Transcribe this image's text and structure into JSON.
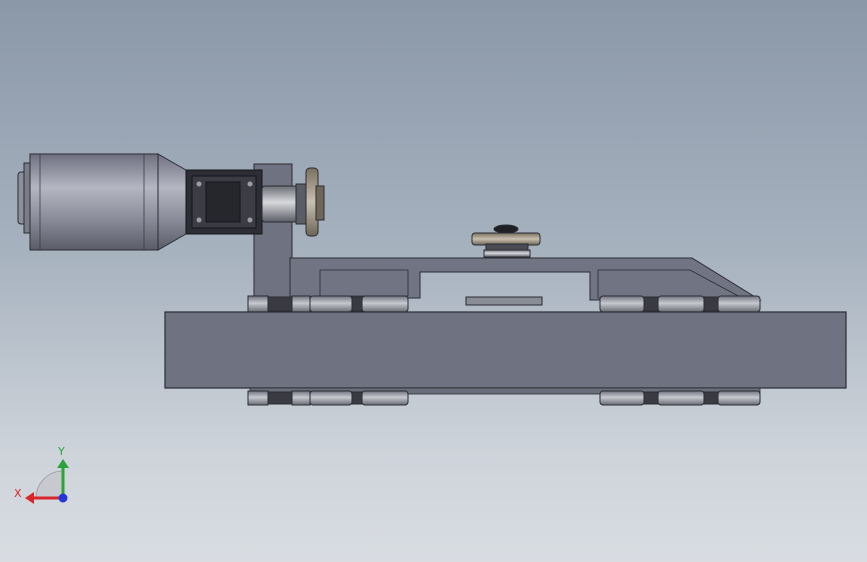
{
  "viewport": {
    "background_top": "#8b98a8",
    "background_bottom": "#d9dde2"
  },
  "triad": {
    "x_label": "X",
    "y_label": "Y",
    "x_color": "#d8262a",
    "y_color": "#2aa43a",
    "z_color": "#2436d6"
  },
  "colors": {
    "body": "#6f7280",
    "edge": "#2a2c33",
    "motor": "#8a8c99",
    "bearing": "#3a3b42"
  }
}
